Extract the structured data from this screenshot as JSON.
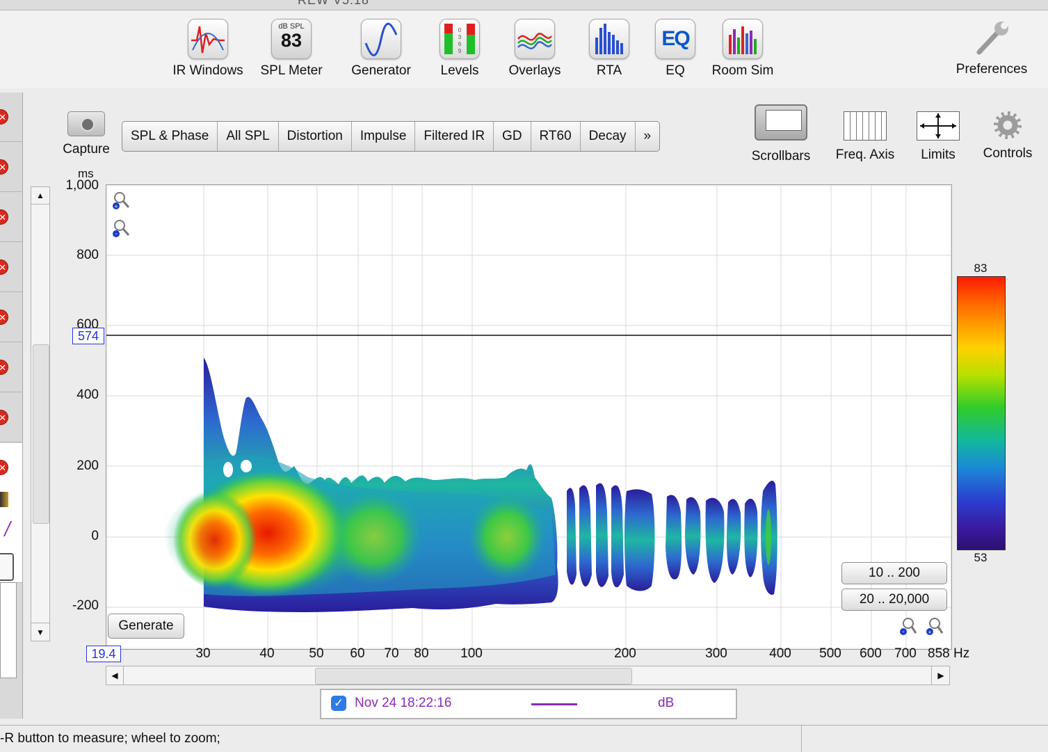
{
  "window": {
    "title": "REW V5.18"
  },
  "toolbar": [
    {
      "label": "IR Windows",
      "icon": "ir-windows-icon"
    },
    {
      "label": "SPL Meter",
      "icon": "spl-meter-icon",
      "meter_caption": "dB SPL",
      "meter_value": "83"
    },
    {
      "label": "Generator",
      "icon": "generator-icon"
    },
    {
      "label": "Levels",
      "icon": "levels-icon"
    },
    {
      "label": "Overlays",
      "icon": "overlays-icon"
    },
    {
      "label": "RTA",
      "icon": "rta-icon"
    },
    {
      "label": "EQ",
      "icon": "eq-icon",
      "icon_text": "EQ"
    },
    {
      "label": "Room Sim",
      "icon": "room-sim-icon"
    },
    {
      "label": "Preferences",
      "icon": "wrench-icon"
    }
  ],
  "capture": {
    "label": "Capture"
  },
  "tabs": [
    "SPL & Phase",
    "All SPL",
    "Distortion",
    "Impulse",
    "Filtered IR",
    "GD",
    "RT60",
    "Decay",
    "»"
  ],
  "right_tools": [
    {
      "label": "Scrollbars",
      "icon": "scrollbars-icon"
    },
    {
      "label": "Freq. Axis",
      "icon": "freq-axis-icon"
    },
    {
      "label": "Limits",
      "icon": "limits-icon"
    },
    {
      "label": "Controls",
      "icon": "gear-icon"
    }
  ],
  "plot": {
    "y_unit": "ms",
    "y_ticks": [
      "1,000",
      "800",
      "600",
      "400",
      "200",
      "0",
      "-200"
    ],
    "x_ticks": [
      "30",
      "40",
      "50",
      "60",
      "70",
      "80",
      "100",
      "200",
      "300",
      "400",
      "500",
      "600",
      "700"
    ],
    "x_end_label": "858 Hz",
    "x_start_value": "19.4",
    "cursor_time": "574",
    "scale_max": "83",
    "scale_min": "53",
    "generate_label": "Generate",
    "range_buttons": [
      "10 .. 200",
      "20 .. 20,000"
    ]
  },
  "chart_data": {
    "type": "heatmap",
    "title": "",
    "xlabel": "Hz",
    "ylabel": "ms",
    "x_scale": "log",
    "xlim": [
      19.4,
      858
    ],
    "ylim": [
      -300,
      1000
    ],
    "color_range_db": [
      53,
      83
    ],
    "cursor_ms": 574,
    "grid": true,
    "colorbar_position": "right",
    "hot_regions": [
      {
        "freq_hz": 40,
        "time_ms": 20,
        "level_db": 83
      },
      {
        "freq_hz": 33,
        "time_ms": 0,
        "level_db": 78
      },
      {
        "freq_hz": 60,
        "time_ms": 0,
        "level_db": 70
      },
      {
        "freq_hz": 100,
        "time_ms": 0,
        "level_db": 69
      },
      {
        "freq_hz": 300,
        "time_ms": 0,
        "level_db": 62
      },
      {
        "freq_hz": 390,
        "time_ms": 0,
        "level_db": 62
      }
    ]
  },
  "legend": {
    "checked": true,
    "label": "Nov 24 18:22:16",
    "unit": "dB",
    "color": "#8a2ab8"
  },
  "status": {
    "text": "-R button to measure; wheel to zoom;"
  }
}
